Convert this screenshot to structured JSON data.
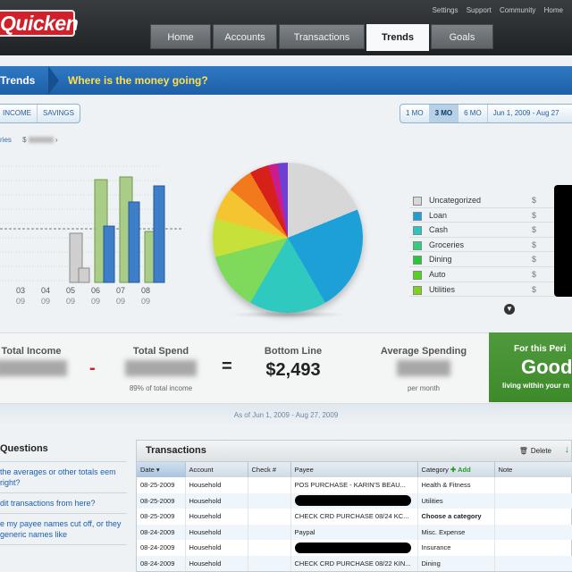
{
  "header": {
    "logo": "Quicken",
    "top_links": [
      "Settings",
      "Support",
      "Community",
      "Home"
    ],
    "tabs": [
      {
        "label": "Home",
        "active": false
      },
      {
        "label": "Accounts",
        "active": false
      },
      {
        "label": "Transactions",
        "active": false
      },
      {
        "label": "Trends",
        "active": true
      },
      {
        "label": "Goals",
        "active": false
      }
    ]
  },
  "section": {
    "name": "Trends",
    "question": "Where is the money going?"
  },
  "filters": {
    "type_buttons": [
      "INCOME",
      "SAVINGS"
    ],
    "period_buttons": [
      {
        "label": "1 MO",
        "selected": false
      },
      {
        "label": "3 MO",
        "selected": true
      },
      {
        "label": "6 MO",
        "selected": false
      },
      {
        "label": "Jun 1, 2009 - Aug 27",
        "selected": false
      }
    ]
  },
  "category_row": {
    "label": "ries",
    "amount_prefix": "$"
  },
  "chart_data": {
    "type": "bar",
    "categories": [
      "03 09",
      "04 09",
      "05 09",
      "06 09",
      "07 09",
      "08 09"
    ],
    "series": [
      {
        "name": "",
        "color": "#c8c8c8",
        "values": [
          0,
          0,
          55,
          16,
          0,
          0
        ]
      },
      {
        "name": "",
        "color": "#a9cc86",
        "values": [
          0,
          0,
          0,
          0,
          118,
          57
        ]
      },
      {
        "name": "",
        "color": "#3e7ec9",
        "values": [
          0,
          0,
          0,
          0,
          0,
          0
        ]
      }
    ],
    "stacked_note_values": {
      "05 09": [
        55,
        16
      ],
      "06 09": [
        115,
        63
      ],
      "07 09": [
        118,
        90
      ],
      "08 09": [
        57,
        108
      ]
    },
    "ylim": [
      0,
      130
    ]
  },
  "pie": {
    "slices": [
      {
        "category": "Uncategorized",
        "color": "#d7d7d7"
      },
      {
        "category": "Loan",
        "color": "#1da0d8"
      },
      {
        "category": "Cash",
        "color": "#2fc9c0"
      },
      {
        "category": "Groceries",
        "color": "#7fd95a"
      },
      {
        "category": "Dining",
        "color": "#c7e03a"
      },
      {
        "category": "Auto",
        "color": "#f4c531"
      },
      {
        "category": "Utilities",
        "color": "#f27a1c"
      }
    ]
  },
  "legend": [
    {
      "label": "Uncategorized",
      "color": "#d8d8d8",
      "currency": "$"
    },
    {
      "label": "Loan",
      "color": "#1c9fd8",
      "currency": "$"
    },
    {
      "label": "Cash",
      "color": "#26c9c1",
      "currency": "$"
    },
    {
      "label": "Groceries",
      "color": "#2ad27a",
      "currency": "$"
    },
    {
      "label": "Dining",
      "color": "#20cc35",
      "currency": "$"
    },
    {
      "label": "Auto",
      "color": "#52d41e",
      "currency": "$"
    },
    {
      "label": "Utilities",
      "color": "#7dd414",
      "currency": "$"
    }
  ],
  "summary": {
    "total_income_label": "Total Income",
    "total_spend_label": "Total Spend",
    "total_spend_sub": "89% of total income",
    "minus": "-",
    "equals": "=",
    "bottom_line_label": "Bottom Line",
    "bottom_line_value": "$2,493",
    "avg_label": "Average Spending",
    "avg_sub": "per month",
    "status_title": "For this Peri",
    "status_value": "Good",
    "status_sub": "living within your m",
    "as_of": "As of Jun 1, 2009 - Aug 27, 2009"
  },
  "questions": {
    "title": "Questions",
    "links": [
      "the averages or other totals eem right?",
      "dit transactions from here?",
      "e my payee names cut off, or they generic names like"
    ]
  },
  "transactions": {
    "title": "Transactions",
    "delete_label": "Delete",
    "columns": [
      "Date",
      "Account",
      "Check #",
      "Payee",
      "Category",
      "Add",
      "Note"
    ],
    "rows": [
      {
        "date": "08-25-2009",
        "account": "Household",
        "check": "",
        "payee": "POS PURCHASE - KARIN'S BEAU...",
        "category": "Health & Fitness",
        "redacted": false,
        "bold": false
      },
      {
        "date": "08-25-2009",
        "account": "Household",
        "check": "",
        "payee": "",
        "category": "Utilities",
        "redacted": true,
        "bold": false
      },
      {
        "date": "08-25-2009",
        "account": "Household",
        "check": "",
        "payee": "CHECK CRD PURCHASE 08/24 KC...",
        "category": "Choose a category",
        "redacted": false,
        "bold": true
      },
      {
        "date": "08-24-2009",
        "account": "Household",
        "check": "",
        "payee": "Paypal",
        "category": "Misc. Expense",
        "redacted": false,
        "bold": false
      },
      {
        "date": "08-24-2009",
        "account": "Household",
        "check": "",
        "payee": "",
        "category": "Insurance",
        "redacted": true,
        "bold": false
      },
      {
        "date": "08-24-2009",
        "account": "Household",
        "check": "",
        "payee": "CHECK CRD PURCHASE 08/22 KIN...",
        "category": "Dining",
        "redacted": false,
        "bold": false
      }
    ]
  }
}
